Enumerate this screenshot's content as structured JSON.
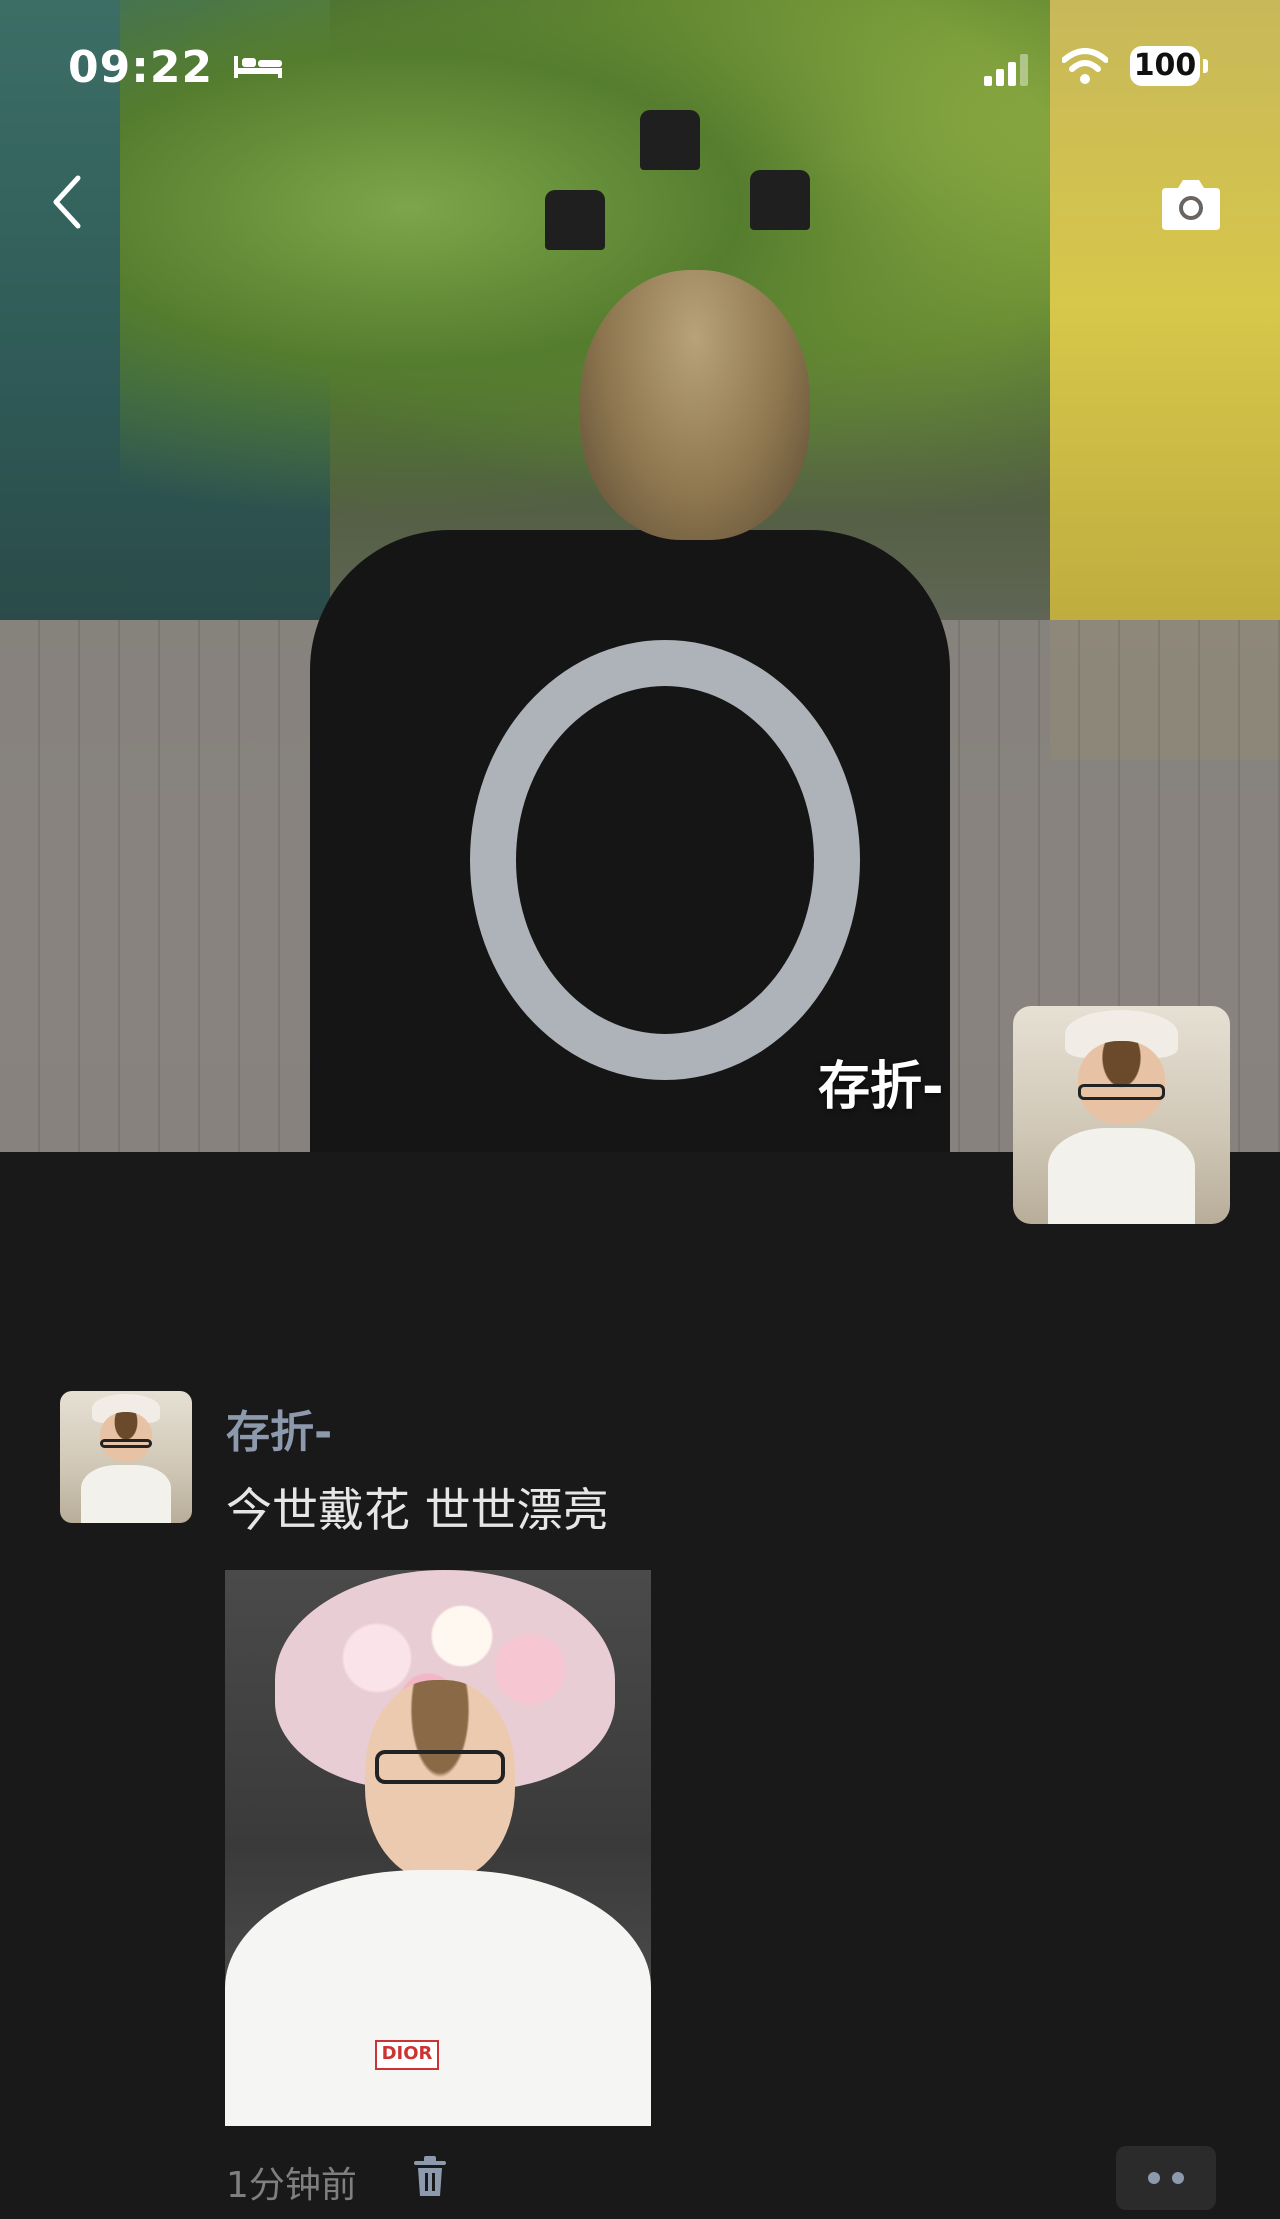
{
  "status_bar": {
    "time": "09:22",
    "battery": "100",
    "icons": [
      "bed-icon",
      "signal-icon",
      "wifi-icon",
      "battery-icon"
    ]
  },
  "header": {
    "back_icon": "chevron-left-icon",
    "camera_icon": "camera-icon"
  },
  "profile": {
    "name": "存折-"
  },
  "post": {
    "author": "存折-",
    "text": "今世戴花 世世漂亮",
    "time": "1分钟前",
    "delete_icon": "trash-icon",
    "more_icon": "more-dots-icon",
    "photo_badge": "DIOR"
  },
  "colors": {
    "background": "#191919",
    "name_link": "#8d99ad",
    "body_text": "#e6e6e6",
    "time_text": "#7f7f7f"
  }
}
